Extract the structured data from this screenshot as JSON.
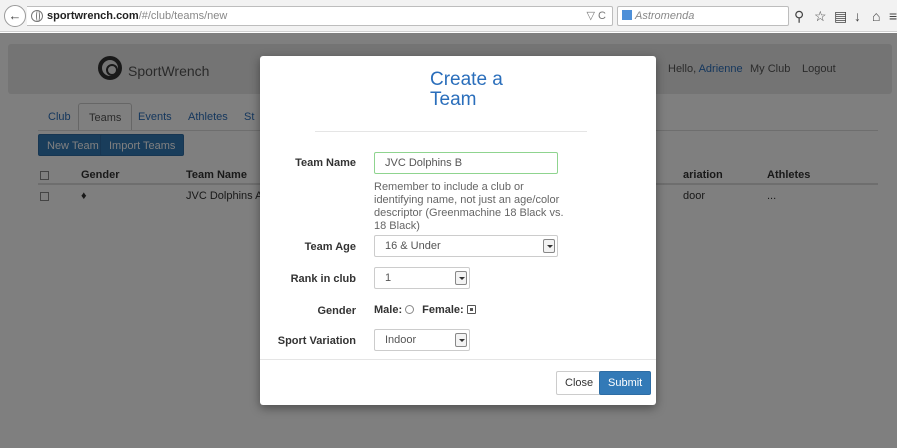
{
  "browser": {
    "url_host": "sportwrench.com",
    "url_path": "/#/club/teams/new",
    "search_engine": "Astromenda",
    "url_icons": "▽ C"
  },
  "header": {
    "brand": "SportWrench",
    "hello": "Hello,",
    "user_name": "Adrienne",
    "my_club": "My Club",
    "logout": "Logout"
  },
  "tabs": [
    {
      "label": "Club"
    },
    {
      "label": "Teams"
    },
    {
      "label": "Events"
    },
    {
      "label": "Athletes"
    },
    {
      "label": "St"
    }
  ],
  "actions": {
    "new_team": "New Team",
    "import_teams": "Import Teams"
  },
  "table": {
    "columns": [
      "Gender",
      "Team Name",
      "ariation",
      "Athletes"
    ],
    "rows": [
      {
        "gender_icon": "♦",
        "team_name": "JVC Dolphins A",
        "variation": "door",
        "athletes": "..."
      }
    ]
  },
  "modal": {
    "title": "Create a Team",
    "team_name_label": "Team Name",
    "team_name_value": "JVC Dolphins B",
    "team_name_help": "Remember to include a club or identifying name, not just an age/color descriptor (Greenmachine 18 Black vs. 18 Black)",
    "team_age_label": "Team Age",
    "team_age_value": "16 & Under",
    "rank_label": "Rank in club",
    "rank_value": "1",
    "gender_label": "Gender",
    "gender_male": "Male:",
    "gender_female": "Female:",
    "sport_variation_label": "Sport Variation",
    "sport_variation_value": "Indoor",
    "close_label": "Close",
    "submit_label": "Submit"
  },
  "colors": {
    "accent": "#337ab7",
    "link": "#2a6ebb",
    "valid_border": "#8fd48f"
  }
}
